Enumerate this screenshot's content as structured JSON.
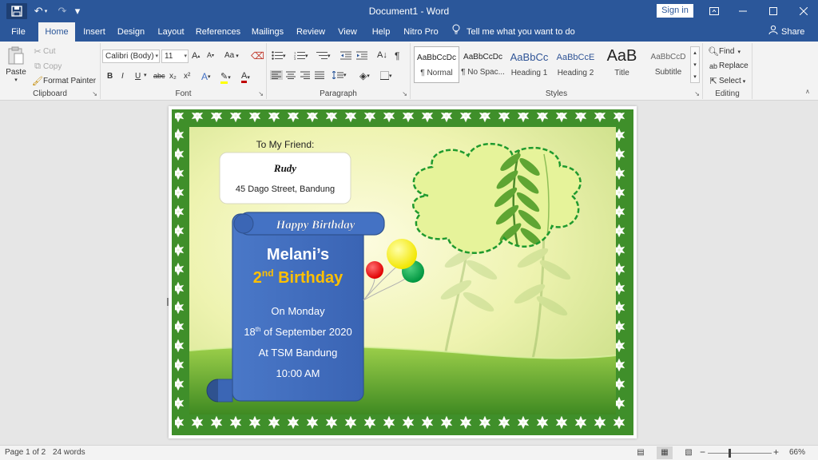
{
  "titlebar": {
    "title": "Document1 - Word",
    "signin_label": "Sign in",
    "icons": {
      "save": "save-icon",
      "undo": "undo-icon",
      "redo": "redo-icon",
      "customize": "customize-quick-access-icon"
    }
  },
  "tabs": [
    {
      "label": "File"
    },
    {
      "label": "Home",
      "active": true
    },
    {
      "label": "Insert"
    },
    {
      "label": "Design"
    },
    {
      "label": "Layout"
    },
    {
      "label": "References"
    },
    {
      "label": "Mailings"
    },
    {
      "label": "Review"
    },
    {
      "label": "View"
    },
    {
      "label": "Help"
    },
    {
      "label": "Nitro Pro"
    }
  ],
  "tellme": {
    "label": "Tell me what you want to do"
  },
  "share": {
    "label": "Share"
  },
  "ribbon": {
    "clipboard": {
      "paste_label": "Paste",
      "cut_label": "Cut",
      "copy_label": "Copy",
      "format_painter_label": "Format Painter",
      "group_label": "Clipboard"
    },
    "font": {
      "font_name": "Calibri (Body)",
      "font_size": "11",
      "change_case_label": "Aa",
      "bold": "B",
      "italic": "I",
      "underline": "U",
      "strikethrough": "abc",
      "subscript": "x₂",
      "superscript": "x²",
      "group_label": "Font"
    },
    "paragraph": {
      "group_label": "Paragraph"
    },
    "styles": {
      "items": [
        {
          "sample": "AaBbCcDc",
          "name": "¶ Normal"
        },
        {
          "sample": "AaBbCcDc",
          "name": "¶ No Spac..."
        },
        {
          "sample": "AaBbCc",
          "name": "Heading 1"
        },
        {
          "sample": "AaBbCcE",
          "name": "Heading 2"
        },
        {
          "sample": "AaB",
          "name": "Title"
        },
        {
          "sample": "AaBbCcD",
          "name": "Subtitle"
        }
      ],
      "group_label": "Styles"
    },
    "editing": {
      "find_label": "Find",
      "replace_label": "Replace",
      "select_label": "Select",
      "group_label": "Editing"
    }
  },
  "card": {
    "to_label": "To My Friend:",
    "recipient_name": "Rudy",
    "recipient_address": "45 Dago Street, Bandung",
    "banner_text": "Happy Birthday",
    "celebrant": "Melani’s",
    "ordinal_number": "2",
    "ordinal_suffix": "nd",
    "birthday_word": "Birthday",
    "day_line": "On Monday",
    "date_day": "18",
    "date_suffix": "th",
    "date_rest": "of September 2020",
    "venue_line": "At TSM Bandung",
    "time_line": "10:00 AM",
    "colors": {
      "border_green": "#3f8f2a",
      "scroll_blue": "#4472c4",
      "scroll_dark": "#2f528f",
      "birthday_gold": "#ffc000",
      "balloon_yellow": "#ffff00",
      "balloon_red": "#ff0000",
      "balloon_green": "#00b050"
    }
  },
  "status": {
    "page_label": "Page 1 of 2",
    "words_label": "24 words",
    "zoom_label": "66%"
  }
}
